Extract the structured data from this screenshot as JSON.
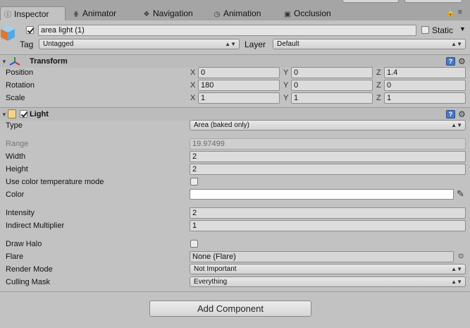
{
  "tabs": [
    {
      "label": "Inspector",
      "icon": "info-icon"
    },
    {
      "label": "Animator",
      "icon": "animator-icon"
    },
    {
      "label": "Navigation",
      "icon": "navigation-icon"
    },
    {
      "label": "Animation",
      "icon": "animation-clock-icon"
    },
    {
      "label": "Occlusion",
      "icon": "occlusion-icon"
    }
  ],
  "object": {
    "name": "area light (1)",
    "active": true,
    "static_label": "Static",
    "static": false,
    "tag_label": "Tag",
    "tag_value": "Untagged",
    "layer_label": "Layer",
    "layer_value": "Default"
  },
  "transform": {
    "title": "Transform",
    "rows": [
      {
        "label": "Position",
        "x": "0",
        "y": "0",
        "z": "1.4"
      },
      {
        "label": "Rotation",
        "x": "180",
        "y": "0",
        "z": "0"
      },
      {
        "label": "Scale",
        "x": "1",
        "y": "1",
        "z": "1"
      }
    ],
    "axes": [
      "X",
      "Y",
      "Z"
    ]
  },
  "light": {
    "title": "Light",
    "enabled": true,
    "type_label": "Type",
    "type_value": "Area (baked only)",
    "range_label": "Range",
    "range_value": "19.97499",
    "width_label": "Width",
    "width_value": "2",
    "height_label": "Height",
    "height_value": "2",
    "temp_label": "Use color temperature mode",
    "temp_checked": false,
    "color_label": "Color",
    "color_value": "#ffffff",
    "intensity_label": "Intensity",
    "intensity_value": "2",
    "indirect_label": "Indirect Multiplier",
    "indirect_value": "1",
    "halo_label": "Draw Halo",
    "halo_checked": false,
    "flare_label": "Flare",
    "flare_value": "None (Flare)",
    "render_label": "Render Mode",
    "render_value": "Not Important",
    "culling_label": "Culling Mask",
    "culling_value": "Everything"
  },
  "add_component": "Add Component"
}
